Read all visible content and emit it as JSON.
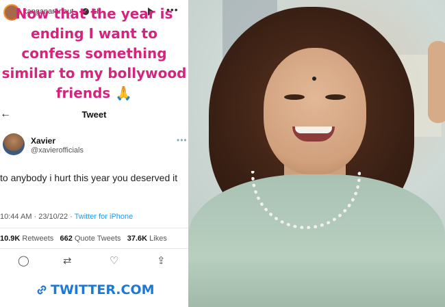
{
  "story": {
    "username": "kanganaranaut",
    "time": "1h",
    "caption": "Now that the year is ending I want to confess something similar to my bollywood friends 🙏"
  },
  "tweet": {
    "back_icon": "back-arrow-icon",
    "title": "Tweet",
    "author_name": "Xavier",
    "author_handle": "@xavierofficials",
    "text": "to anybody i hurt this year you deserved it",
    "time": "10:44 AM",
    "date": "23/10/22",
    "client": "Twitter for iPhone",
    "retweets_count": "10.9K",
    "retweets_label": "Retweets",
    "quotes_count": "662",
    "quotes_label": "Quote Tweets",
    "likes_count": "37.6K",
    "likes_label": "Likes"
  },
  "link_sticker": {
    "text": "TWITTER.COM"
  },
  "colors": {
    "caption": "#d3247e",
    "link": "#1d78d6",
    "client": "#1d9bf0"
  }
}
